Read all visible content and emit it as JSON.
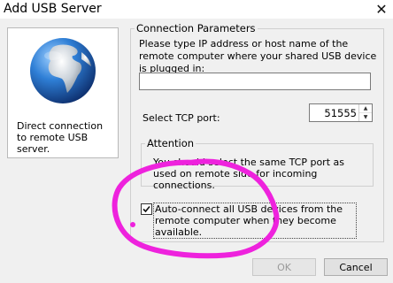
{
  "window": {
    "title": "Add USB Server",
    "close_glyph": "✕"
  },
  "left_panel": {
    "icon": "globe-icon",
    "description": "Direct connection to remote USB server."
  },
  "connection": {
    "group_label": "Connection Parameters",
    "instructions": "Please type IP address or host name of the remote computer where your shared USB device is plugged in:",
    "host_value": "",
    "port_label": "Select TCP port:",
    "port_value": "51555"
  },
  "attention": {
    "group_label": "Attention",
    "text": "You should select the same TCP port as used on remote side for incoming connections."
  },
  "auto_connect": {
    "checked": true,
    "label": "Auto-connect all USB devices from the remote computer when they become available."
  },
  "buttons": {
    "ok": "OK",
    "cancel": "Cancel"
  },
  "colors": {
    "annotation": "#ee22dd",
    "globe_ocean": "#2a6fc2",
    "globe_land": "#c7cfd8"
  }
}
